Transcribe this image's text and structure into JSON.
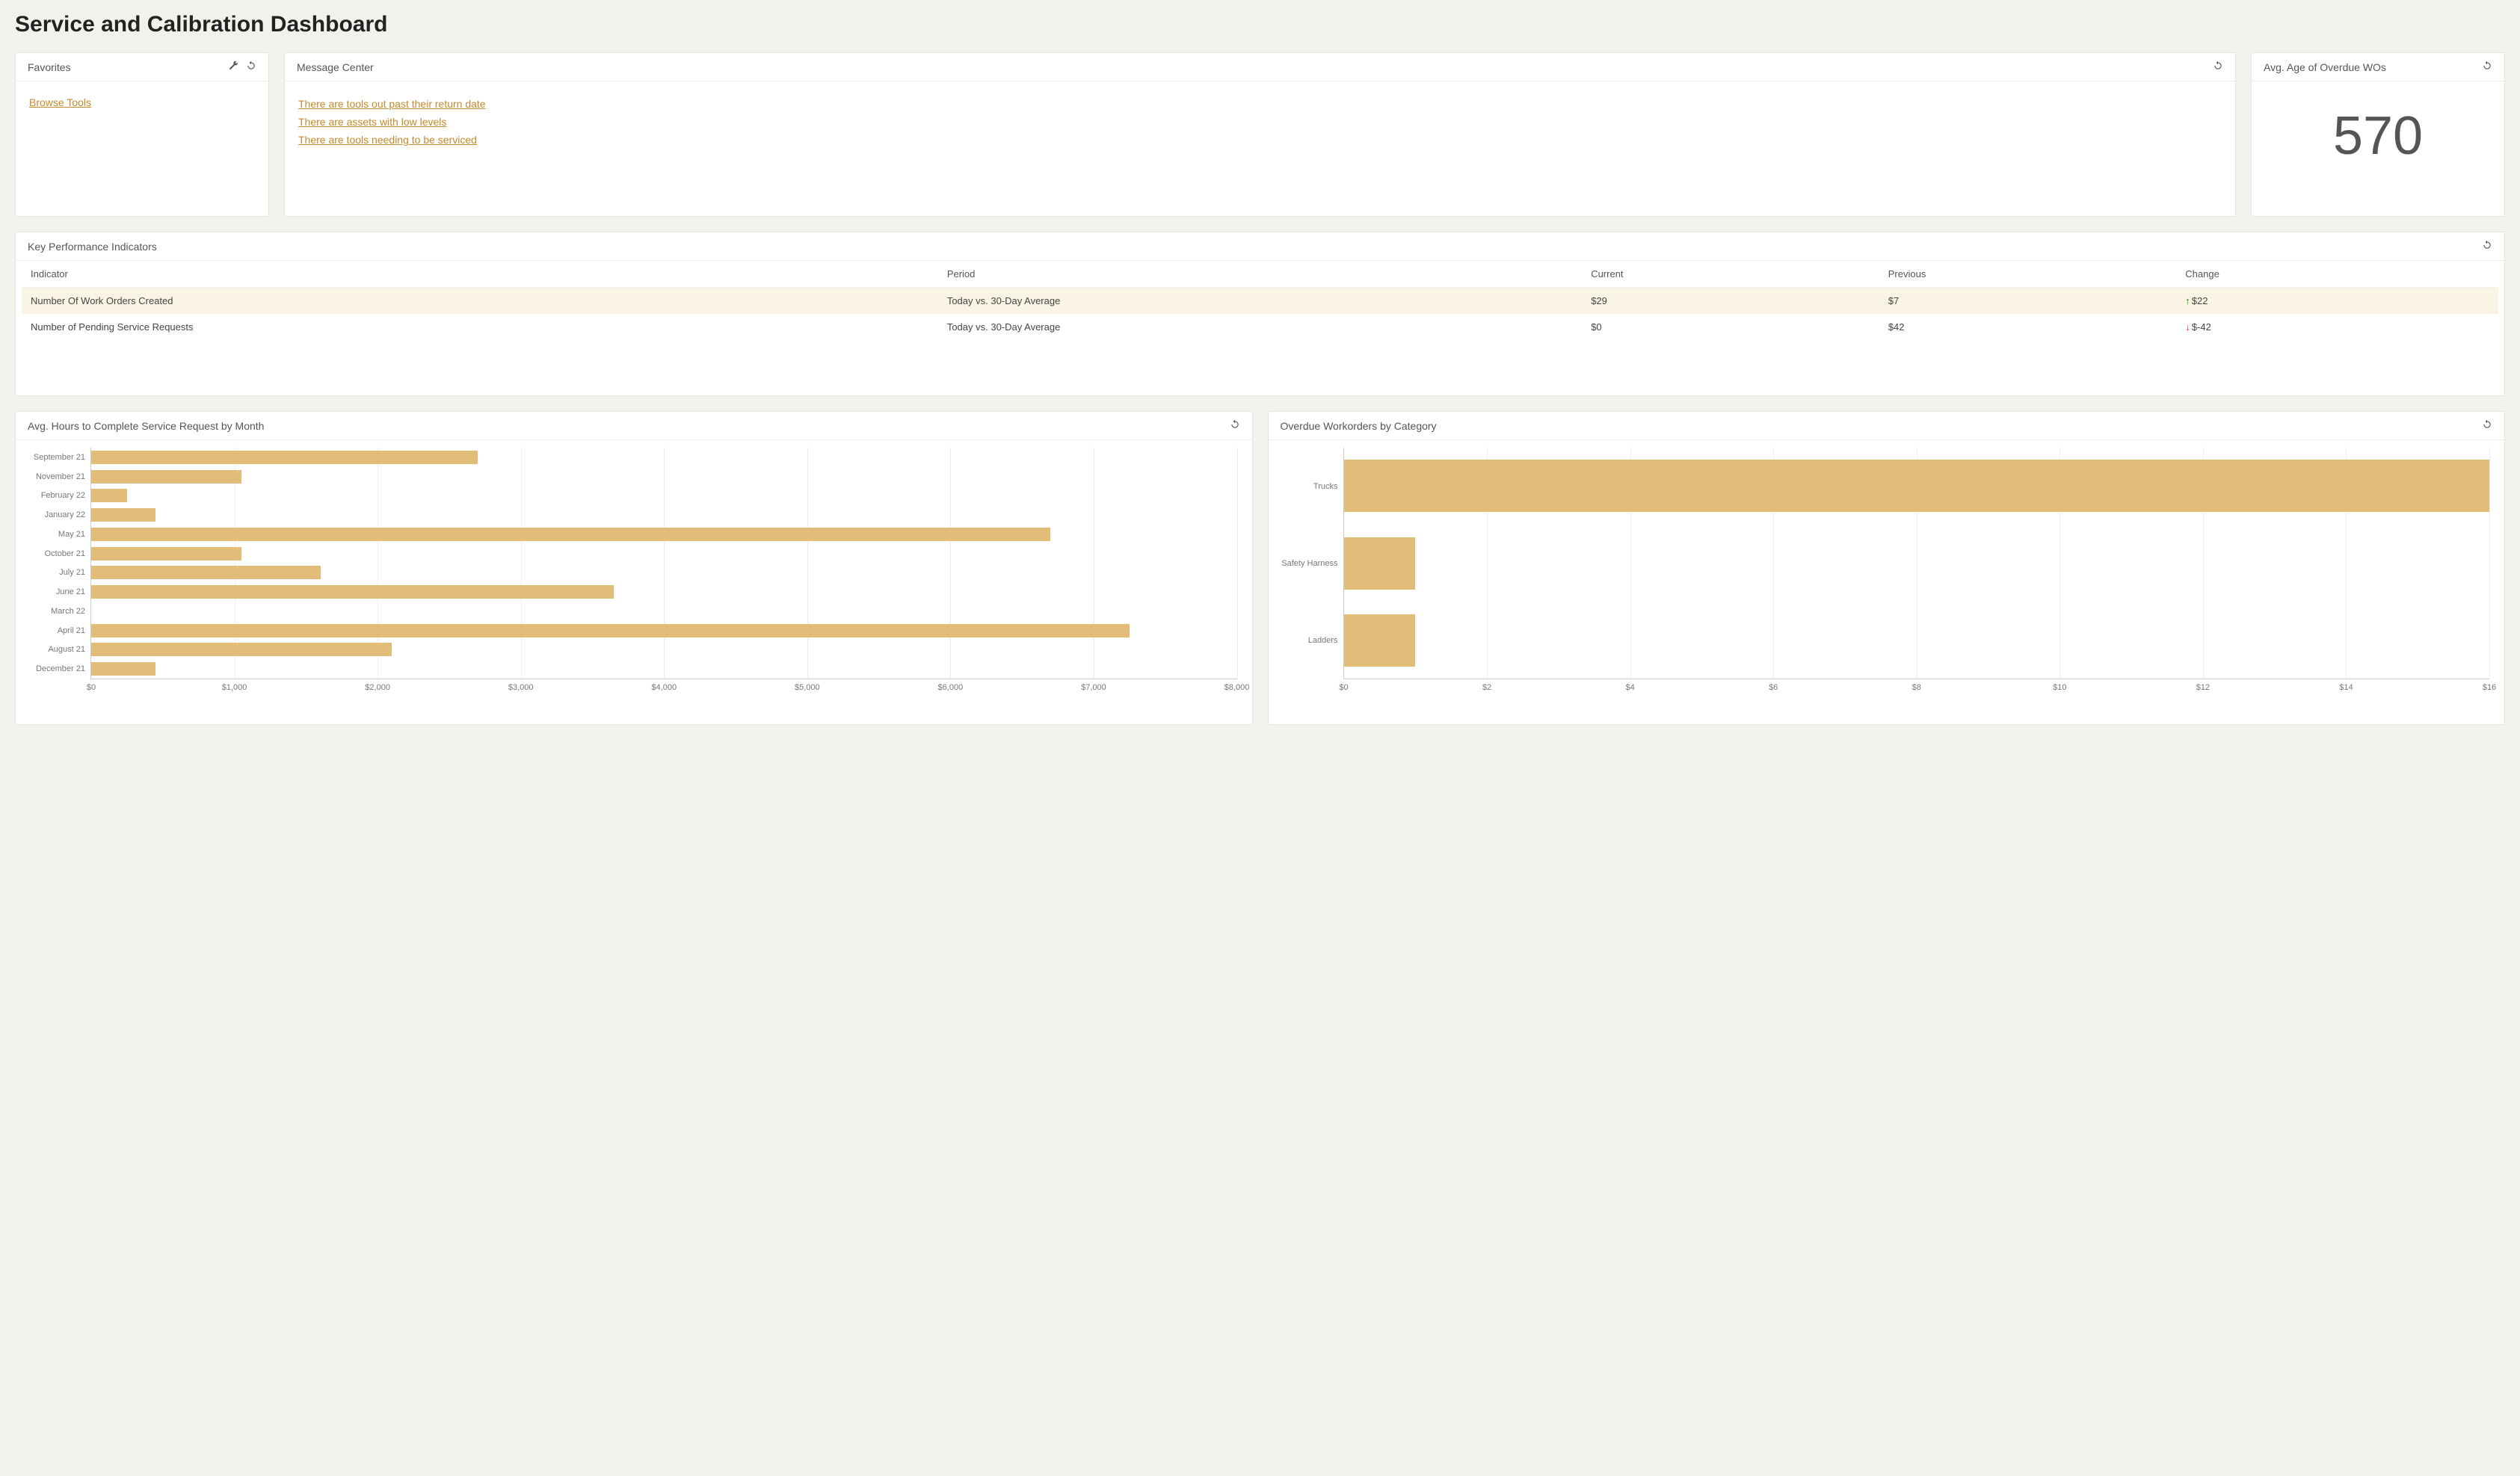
{
  "page_title": "Service and Calibration Dashboard",
  "favorites": {
    "title": "Favorites",
    "links": [
      "Browse Tools"
    ]
  },
  "message_center": {
    "title": "Message Center",
    "messages": [
      "There are tools out past their return date",
      "There are assets with low levels",
      "There are tools needing to be serviced"
    ]
  },
  "avg_overdue": {
    "title": "Avg. Age of Overdue WOs",
    "value": "570"
  },
  "kpi": {
    "title": "Key Performance Indicators",
    "headers": [
      "Indicator",
      "Period",
      "Current",
      "Previous",
      "Change"
    ],
    "rows": [
      {
        "indicator": "Number Of Work Orders Created",
        "period": "Today vs. 30-Day Average",
        "current": "$29",
        "previous": "$7",
        "change_dir": "up",
        "change": "$22",
        "hl": true
      },
      {
        "indicator": "Number of Pending Service Requests",
        "period": "Today vs. 30-Day Average",
        "current": "$0",
        "previous": "$42",
        "change_dir": "down",
        "change": "$-42",
        "hl": false
      }
    ]
  },
  "chart_left": {
    "title": "Avg. Hours to Complete Service Request by Month"
  },
  "chart_right": {
    "title": "Overdue Workorders by Category"
  },
  "chart_data": [
    {
      "type": "bar",
      "orientation": "horizontal",
      "title": "Avg. Hours to Complete Service Request by Month",
      "xlabel": "",
      "ylabel": "",
      "xlim": [
        0,
        8000
      ],
      "x_ticks": [
        0,
        1000,
        2000,
        3000,
        4000,
        5000,
        6000,
        7000,
        8000
      ],
      "x_tick_labels": [
        "$0",
        "$1,000",
        "$2,000",
        "$3,000",
        "$4,000",
        "$5,000",
        "$6,000",
        "$7,000",
        "$8,000"
      ],
      "categories": [
        "September 21",
        "November 21",
        "February 22",
        "January 22",
        "May 21",
        "October 21",
        "July 21",
        "June 21",
        "March 22",
        "April 21",
        "August 21",
        "December 21"
      ],
      "values": [
        2700,
        1050,
        250,
        450,
        6700,
        1050,
        1600,
        3650,
        0,
        7250,
        2100,
        450
      ]
    },
    {
      "type": "bar",
      "orientation": "horizontal",
      "title": "Overdue Workorders by Category",
      "xlabel": "",
      "ylabel": "",
      "xlim": [
        0,
        16
      ],
      "x_ticks": [
        0,
        2,
        4,
        6,
        8,
        10,
        12,
        14,
        16
      ],
      "x_tick_labels": [
        "$0",
        "$2",
        "$4",
        "$6",
        "$8",
        "$10",
        "$12",
        "$14",
        "$16"
      ],
      "categories": [
        "Trucks",
        "Safety Harness",
        "Ladders"
      ],
      "values": [
        16,
        1,
        1
      ]
    }
  ]
}
